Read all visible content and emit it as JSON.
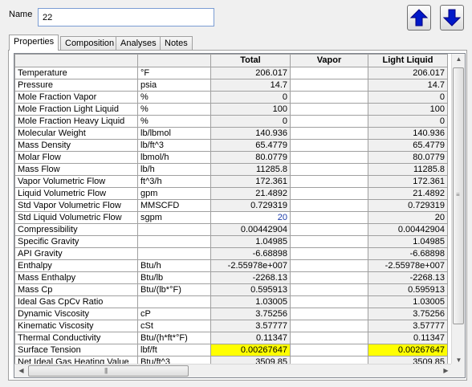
{
  "name_label": "Name",
  "name_value": "22",
  "tabs": [
    "Properties",
    "Composition",
    "Analyses",
    "Notes"
  ],
  "columns": [
    "",
    "",
    "Total",
    "Vapor",
    "Light Liquid"
  ],
  "rows": [
    {
      "prop": "Temperature",
      "unit": "°F",
      "total": "206.017",
      "vapor": "",
      "light": "206.017"
    },
    {
      "prop": "Pressure",
      "unit": "psia",
      "total": "14.7",
      "vapor": "",
      "light": "14.7"
    },
    {
      "prop": "Mole Fraction Vapor",
      "unit": "%",
      "total": "0",
      "vapor": "",
      "light": "0"
    },
    {
      "prop": "Mole Fraction Light Liquid",
      "unit": "%",
      "total": "100",
      "vapor": "",
      "light": "100"
    },
    {
      "prop": "Mole Fraction Heavy Liquid",
      "unit": "%",
      "total": "0",
      "vapor": "",
      "light": "0"
    },
    {
      "prop": "Molecular Weight",
      "unit": "lb/lbmol",
      "total": "140.936",
      "vapor": "",
      "light": "140.936"
    },
    {
      "prop": "Mass Density",
      "unit": "lb/ft^3",
      "total": "65.4779",
      "vapor": "",
      "light": "65.4779"
    },
    {
      "prop": "Molar Flow",
      "unit": "lbmol/h",
      "total": "80.0779",
      "vapor": "",
      "light": "80.0779"
    },
    {
      "prop": "Mass Flow",
      "unit": "lb/h",
      "total": "11285.8",
      "vapor": "",
      "light": "11285.8"
    },
    {
      "prop": "Vapor Volumetric Flow",
      "unit": "ft^3/h",
      "total": "172.361",
      "vapor": "",
      "light": "172.361"
    },
    {
      "prop": "Liquid Volumetric Flow",
      "unit": "gpm",
      "total": "21.4892",
      "vapor": "",
      "light": "21.4892"
    },
    {
      "prop": "Std Vapor Volumetric Flow",
      "unit": "MMSCFD",
      "total": "0.729319",
      "vapor": "",
      "light": "0.729319"
    },
    {
      "prop": "Std Liquid Volumetric Flow",
      "unit": "sgpm",
      "total": "20",
      "vapor": "",
      "light": "20"
    },
    {
      "prop": "Compressibility",
      "unit": "",
      "total": "0.00442904",
      "vapor": "",
      "light": "0.00442904"
    },
    {
      "prop": "Specific Gravity",
      "unit": "",
      "total": "1.04985",
      "vapor": "",
      "light": "1.04985"
    },
    {
      "prop": "API Gravity",
      "unit": "",
      "total": "-6.68898",
      "vapor": "",
      "light": "-6.68898"
    },
    {
      "prop": "Enthalpy",
      "unit": "Btu/h",
      "total": "-2.55978e+007",
      "vapor": "",
      "light": "-2.55978e+007"
    },
    {
      "prop": "Mass Enthalpy",
      "unit": "Btu/lb",
      "total": "-2268.13",
      "vapor": "",
      "light": "-2268.13"
    },
    {
      "prop": "Mass Cp",
      "unit": "Btu/(lb*°F)",
      "total": "0.595913",
      "vapor": "",
      "light": "0.595913"
    },
    {
      "prop": "Ideal Gas CpCv Ratio",
      "unit": "",
      "total": "1.03005",
      "vapor": "",
      "light": "1.03005"
    },
    {
      "prop": "Dynamic Viscosity",
      "unit": "cP",
      "total": "3.75256",
      "vapor": "",
      "light": "3.75256"
    },
    {
      "prop": "Kinematic Viscosity",
      "unit": "cSt",
      "total": "3.57777",
      "vapor": "",
      "light": "3.57777"
    },
    {
      "prop": "Thermal Conductivity",
      "unit": "Btu/(h*ft*°F)",
      "total": "0.11347",
      "vapor": "",
      "light": "0.11347"
    },
    {
      "prop": "Surface Tension",
      "unit": "lbf/ft",
      "total": "0.00267647",
      "vapor": "",
      "light": "0.00267647"
    },
    {
      "prop": "Net Ideal Gas Heating Value",
      "unit": "Btu/ft^3",
      "total": "3509.85",
      "vapor": "",
      "light": "3509.85"
    }
  ],
  "highlight_color": "#ffff00",
  "input_value_color": "#1a3aa8",
  "icons": {
    "up": "up-arrow-icon",
    "down": "down-arrow-icon"
  }
}
